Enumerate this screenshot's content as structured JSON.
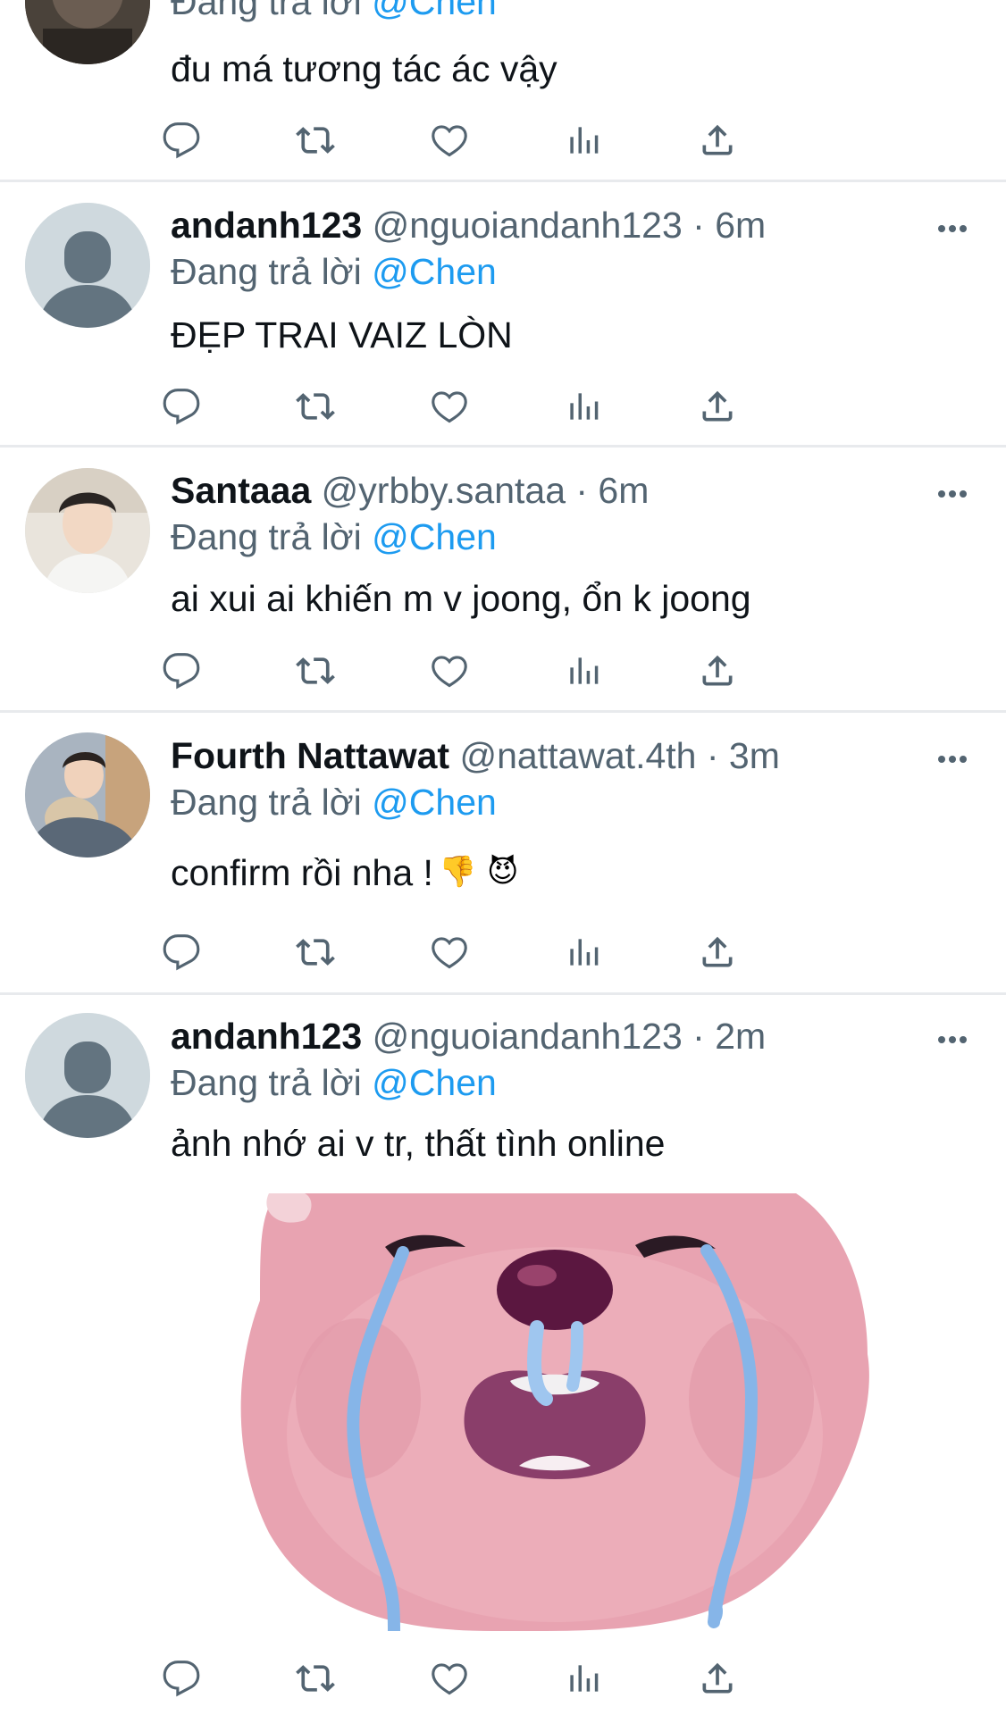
{
  "tweets": [
    {
      "reply_prefix": "Đang trả lời",
      "mention": "@Chen",
      "text": "đu má tương tác ác vậy"
    },
    {
      "name": "andanh123",
      "handle": "@nguoiandanh123 · 6m",
      "reply_prefix": "Đang trả lời",
      "mention": "@Chen",
      "text": "ĐẸP TRAI VAIZ LÒN"
    },
    {
      "name": "Santaaa",
      "handle": "@yrbby.santaa · 6m",
      "reply_prefix": "Đang trả lời",
      "mention": "@Chen",
      "text": "ai xui ai khiến m v joong, ổn k joong"
    },
    {
      "name": "Fourth Nattawat",
      "handle": "@nattawat.4th · 3m",
      "reply_prefix": "Đang trả lời",
      "mention": "@Chen",
      "text": "confirm rồi nha !",
      "emojis": [
        "👎",
        "😈"
      ]
    },
    {
      "name": "andanh123",
      "handle": "@nguoiandanh123 · 2m",
      "reply_prefix": "Đang trả lời",
      "mention": "@Chen",
      "text": "ảnh nhớ ai v tr, thất tình online",
      "media": "crying-pink-beaver-sticker"
    }
  ],
  "icons": [
    "reply-icon",
    "retweet-icon",
    "like-icon",
    "views-icon",
    "share-icon",
    "more-icon"
  ],
  "colors": {
    "mention": "#1d9bf0",
    "secondary_text": "#536471",
    "divider": "#e8eaed"
  }
}
